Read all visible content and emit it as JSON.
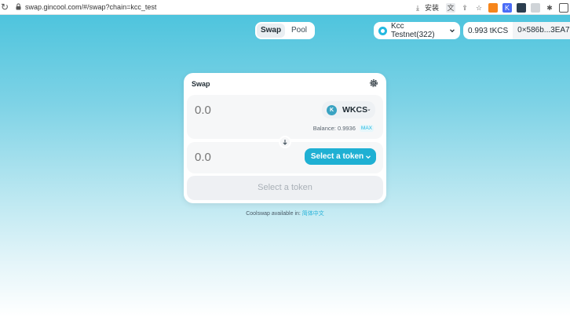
{
  "browser": {
    "url": "swap.gincool.com/#/swap?chain=kcc_test",
    "install_label": "安装"
  },
  "nav": {
    "tabs": [
      {
        "label": "Swap",
        "active": true
      },
      {
        "label": "Pool",
        "active": false
      }
    ]
  },
  "network": {
    "label": "Kcc Testnet(322)"
  },
  "account": {
    "balance": "0.993 tKCS",
    "address": "0×586b...3EA7"
  },
  "swap": {
    "title": "Swap",
    "from": {
      "amount_placeholder": "0.0",
      "token": "WKCS",
      "balance_label": "Balance: 0.9936",
      "max_label": "MAX"
    },
    "to": {
      "amount_placeholder": "0.0",
      "select_label": "Select a token"
    },
    "submit_label": "Select a token"
  },
  "footer": {
    "text": "Coolswap available in: ",
    "link": "简体中文"
  },
  "colors": {
    "accent": "#1fb0d3",
    "background_top": "#4ec4dd"
  }
}
